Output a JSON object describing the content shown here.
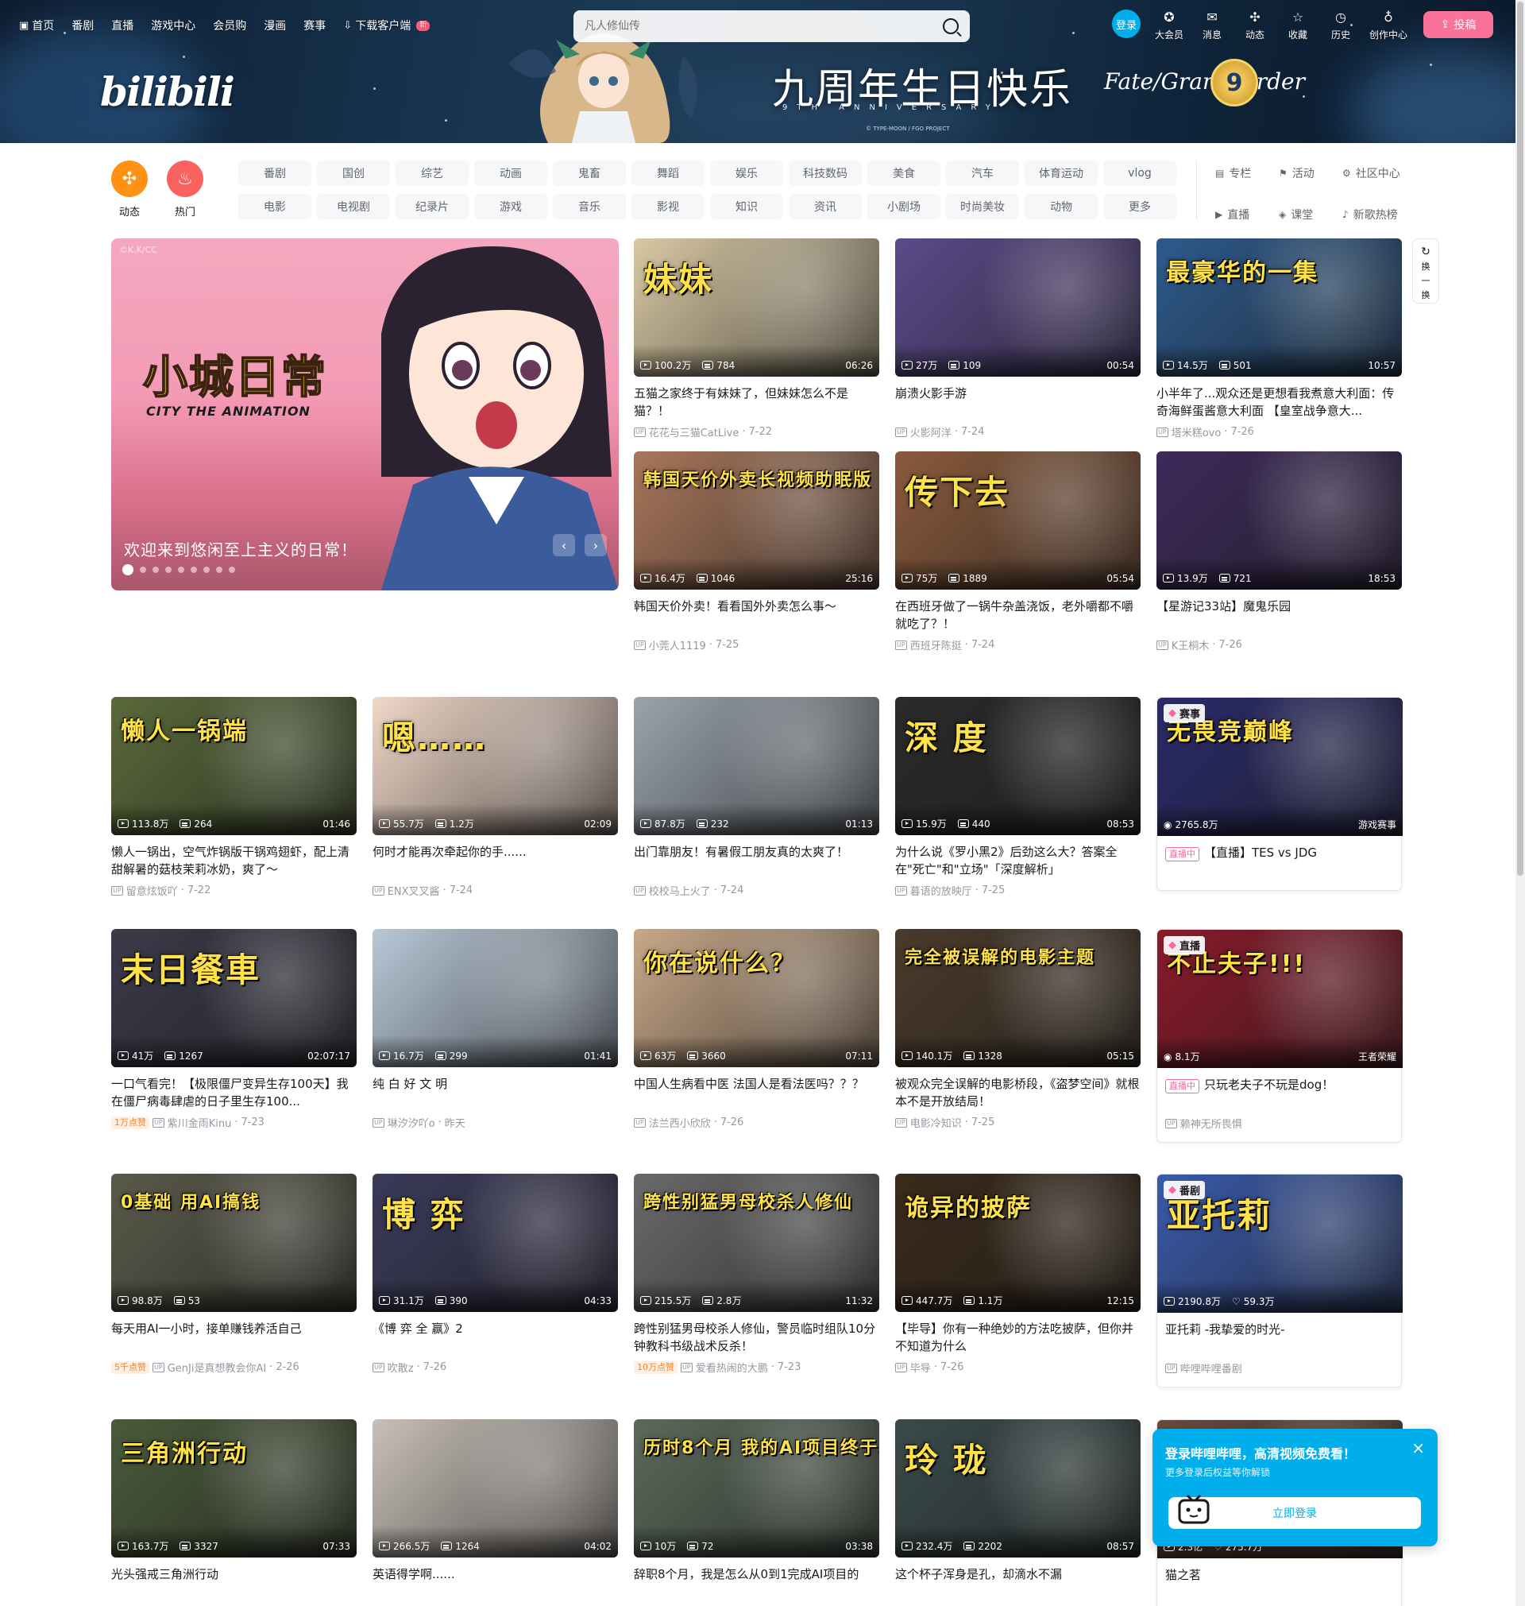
{
  "header": {
    "nav_left": [
      "首页",
      "番剧",
      "直播",
      "游戏中心",
      "会员购",
      "漫画",
      "赛事",
      "下载客户端"
    ],
    "new_tag": "新",
    "search_placeholder": "凡人修仙传",
    "login": "登录",
    "nav_right": [
      "大会员",
      "消息",
      "动态",
      "收藏",
      "历史",
      "创作中心"
    ],
    "upload": "投稿",
    "logo": "bilibili",
    "banner_title": "九周年生日快乐",
    "banner_subtitle": "9TH ANNIVERSARY",
    "banner_brand": "Fate/Grand Order",
    "banner_badge": "9",
    "banner_copyright": "© TYPE-MOON / FGO PROJECT"
  },
  "channels": {
    "big": [
      {
        "label": "动态",
        "color": "#ff9212"
      },
      {
        "label": "热门",
        "color": "#f9625f"
      }
    ],
    "tags": [
      "番剧",
      "国创",
      "综艺",
      "动画",
      "鬼畜",
      "舞蹈",
      "娱乐",
      "科技数码",
      "美食",
      "汽车",
      "体育运动",
      "vlog",
      "电影",
      "电视剧",
      "纪录片",
      "游戏",
      "音乐",
      "影视",
      "知识",
      "资讯",
      "小剧场",
      "时尚美妆",
      "动物",
      "更多"
    ],
    "extra": [
      "专栏",
      "活动",
      "社区中心",
      "直播",
      "课堂",
      "新歌热榜"
    ]
  },
  "carousel": {
    "copyright": "©K.K/CC",
    "title_art": "小城日常",
    "subtitle_art": "CITY THE ANIMATION",
    "caption": "欢迎来到悠闲至上主义的日常！",
    "dots": 9,
    "active_dot": 0
  },
  "refresh": {
    "label_top": "换",
    "label_bot": "一换"
  },
  "videos": [
    {
      "title": "五猫之家终于有妹妹了，但妹妹怎么不是猫？！",
      "author": "花花与三猫CatLive",
      "date": "7-22",
      "views": "100.2万",
      "danmaku": "784",
      "duration": "06:26",
      "art": "妹妹",
      "bg": "#d9c9a4"
    },
    {
      "title": "崩溃火影手游",
      "author": "火影阿洋",
      "date": "7-24",
      "views": "27万",
      "danmaku": "109",
      "duration": "00:54",
      "art": "",
      "bg": "#5b4a8a"
    },
    {
      "title": "小半年了...观众还是更想看我煮意大利面：传奇海鲜蛋酱意大利面 【皇室战争意大...",
      "author": "塔米糕ovo",
      "date": "7-26",
      "views": "14.5万",
      "danmaku": "501",
      "duration": "10:57",
      "art": "最豪华的一集",
      "bg": "#2d5a8c"
    },
    {
      "title": "韩国天价外卖！看看国外外卖怎么事～",
      "author": "小莞人1119",
      "date": "7-25",
      "views": "16.4万",
      "danmaku": "1046",
      "duration": "25:16",
      "art": "韩国天价外卖长视频助眠版",
      "bg": "#a8765a"
    },
    {
      "title": "在西班牙做了一锅牛杂盖浇饭，老外嚼都不嚼就吃了？！",
      "author": "西班牙陈挺",
      "date": "7-24",
      "views": "75万",
      "danmaku": "1889",
      "duration": "05:54",
      "art": "传下去",
      "bg": "#8a5a3c"
    },
    {
      "title": "【星游记33站】魔鬼乐园",
      "author": "K王桐木",
      "date": "7-26",
      "views": "13.9万",
      "danmaku": "721",
      "duration": "18:53",
      "art": "",
      "bg": "#3c2a5a"
    },
    {
      "title": "懒人一锅出，空气炸锅版干锅鸡翅虾，配上清甜解暑的菇枝茉莉冰奶，爽了～",
      "author": "留意炫饭吖",
      "date": "7-22",
      "views": "113.8万",
      "danmaku": "264",
      "duration": "01:46",
      "art": "懒人一锅端",
      "bg": "#5a6a3a"
    },
    {
      "title": "何时才能再次牵起你的手......",
      "author": "ENX叉叉酱",
      "date": "7-24",
      "views": "55.7万",
      "danmaku": "1.2万",
      "duration": "02:09",
      "art": "嗯……",
      "bg": "#f0d8c8"
    },
    {
      "title": "出门靠朋友！有暑假工朋友真的太爽了！",
      "author": "校校马上火了",
      "date": "7-24",
      "views": "87.8万",
      "danmaku": "232",
      "duration": "01:13",
      "art": "",
      "bg": "#9aa3ad"
    },
    {
      "title": "为什么说《罗小黑2》后劲这么大？答案全在\"死亡\"和\"立场\"「深度解析」",
      "author": "暮语的放映厅",
      "date": "7-25",
      "views": "15.9万",
      "danmaku": "440",
      "duration": "08:53",
      "art": "深 度",
      "bg": "#2a2a2a"
    },
    {
      "title": "一口气看完！【极限僵尸变异生存100天】我在僵尸病毒肆虐的日子里生存100...",
      "author": "紫川金雨Kinu",
      "date": "7-23",
      "views": "41万",
      "danmaku": "1267",
      "duration": "02:07:17",
      "art": "末日餐車",
      "bg": "#3a3a4a",
      "likes": "1万点赞"
    },
    {
      "title": "纯 白 好 文 明",
      "author": "琳汐汐吖o",
      "date": "昨天",
      "views": "16.7万",
      "danmaku": "299",
      "duration": "01:41",
      "art": "",
      "bg": "#b8c8d8"
    },
    {
      "title": "中国人生病看中医 法国人是看法医吗？？？",
      "author": "法兰西小欣欣",
      "date": "7-26",
      "views": "63万",
      "danmaku": "3660",
      "duration": "07:11",
      "art": "你在说什么？",
      "bg": "#c8a888"
    },
    {
      "title": "被观众完全误解的电影桥段，《盗梦空间》就根本不是开放结局！",
      "author": "电影冷知识",
      "date": "7-25",
      "views": "140.1万",
      "danmaku": "1328",
      "duration": "05:15",
      "art": "完全被误解的电影主题",
      "bg": "#4a3a2a"
    },
    {
      "title": "每天用AI一小时，接单赚钱养活自己",
      "author": "GenJi是真想教会你AI",
      "date": "2-26",
      "views": "98.8万",
      "danmaku": "53",
      "duration": "",
      "art": "0基础 用AI搞钱",
      "bg": "#5a5a4a",
      "likes": "5千点赞"
    },
    {
      "title": "《博 弈 全 赢》2",
      "author": "吹散z",
      "date": "7-26",
      "views": "31.1万",
      "danmaku": "390",
      "duration": "04:33",
      "art": "博 弈",
      "bg": "#3a3a5a"
    },
    {
      "title": "跨性别猛男母校杀人修仙，警员临时组队10分钟教科书级战术反杀！",
      "author": "爱看热闹的大鹏",
      "date": "7-23",
      "views": "215.5万",
      "danmaku": "2.8万",
      "duration": "11:32",
      "art": "跨性别猛男母校杀人修仙",
      "bg": "#6a6a6a",
      "likes": "10万点赞"
    },
    {
      "title": "【毕导】你有一种绝妙的方法吃披萨，但你并不知道为什么",
      "author": "毕导",
      "date": "7-26",
      "views": "447.7万",
      "danmaku": "1.1万",
      "duration": "12:15",
      "art": "诡异的披萨",
      "bg": "#3a2a1a"
    },
    {
      "title": "光头强戒三角洲行动",
      "author": "",
      "date": "",
      "views": "163.7万",
      "danmaku": "3327",
      "duration": "07:33",
      "art": "三角洲行动",
      "bg": "#4a5a3a"
    },
    {
      "title": "英语得学啊......",
      "author": "",
      "date": "",
      "views": "266.5万",
      "danmaku": "1264",
      "duration": "04:02",
      "art": "",
      "bg": "#c8c0b8"
    },
    {
      "title": "辞职8个月，我是怎么从0到1完成AI项目的",
      "author": "",
      "date": "",
      "views": "10万",
      "danmaku": "72",
      "duration": "03:38",
      "art": "历时8个月 我的AI项目终于上线",
      "bg": "#5a6a5a"
    },
    {
      "title": "这个杯子浑身是孔，却滴水不漏",
      "author": "",
      "date": "",
      "views": "232.4万",
      "danmaku": "2202",
      "duration": "08:57",
      "art": "玲 珑",
      "bg": "#3a4a4a"
    }
  ],
  "specials": [
    {
      "corner": "赛事",
      "title": "【直播】TES vs JDG",
      "live_tag": "直播中",
      "online": "2765.8万",
      "category": "游戏赛事",
      "art": "无畏竞巅峰",
      "bg": "#2a2a6a"
    },
    {
      "corner": "直播",
      "title": "只玩老夫子不玩是dog！",
      "live_tag": "直播中",
      "author": "赖神无所畏惧",
      "online": "8.1万",
      "category": "王者荣耀",
      "art": "不止夫子!!!",
      "bg": "#8a1a2a"
    },
    {
      "corner": "番剧",
      "title": "亚托莉 -我挚爱的时光-",
      "author": "哔哩哔哩番剧",
      "views": "2190.8万",
      "follows": "59.3万",
      "art": "亚托莉",
      "bg": "#3a5aaa"
    },
    {
      "corner": "",
      "title": "猫之茗",
      "views": "2.3亿",
      "follows": "275.7万",
      "art": "",
      "bg": "#6a4a3a"
    }
  ],
  "login_popup": {
    "title": "登录哔哩哔哩，高清视频免费看！",
    "subtitle": "更多登录后权益等你解锁",
    "button": "立即登录"
  }
}
